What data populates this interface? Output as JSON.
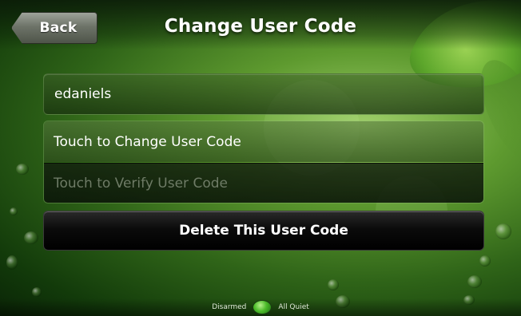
{
  "header": {
    "back_label": "Back",
    "title": "Change User Code"
  },
  "user": {
    "username": "edaniels"
  },
  "actions": {
    "change_label": "Touch to Change User Code",
    "verify_label": "Touch to Verify User Code",
    "delete_label": "Delete This User Code"
  },
  "status": {
    "arm_state": "Disarmed",
    "system_state": "All Quiet"
  },
  "icons": {
    "status": "status-indicator-icon"
  },
  "colors": {
    "accent_green": "#4cbb2a",
    "verify_text_disabled": "#6e7b66"
  }
}
